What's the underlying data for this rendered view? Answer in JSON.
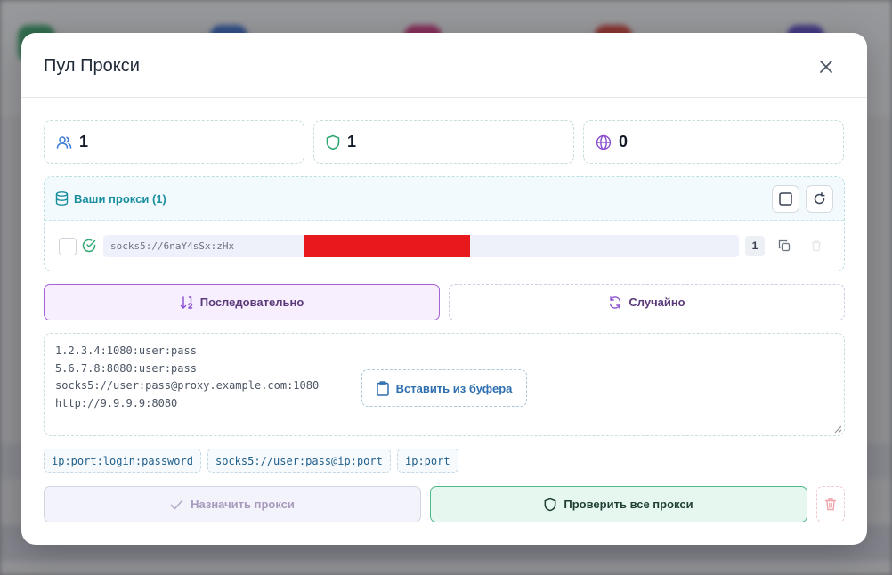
{
  "modal": {
    "title": "Пул Прокси"
  },
  "stats": {
    "users": "1",
    "valid": "1",
    "countries": "0"
  },
  "proxy_panel": {
    "title": "Ваши прокси (1)",
    "items": [
      {
        "value": "socks5://6naY4sSx:zHx",
        "count": "1",
        "status": "valid"
      }
    ]
  },
  "mode": {
    "sequential_label": "Последовательно",
    "random_label": "Случайно",
    "selected": "sequential"
  },
  "input": {
    "lines": [
      "1.2.3.4:1080:user:pass",
      "5.6.7.8:8080:user:pass",
      "socks5://user:pass@proxy.example.com:1080",
      "http://9.9.9.9:8080"
    ],
    "paste_label": "Вставить из буфера"
  },
  "formats": [
    "ip:port:login:password",
    "socks5://user:pass@ip:port",
    "ip:port"
  ],
  "actions": {
    "assign_label": "Назначить прокси",
    "check_label": "Проверить все прокси"
  },
  "colors": {
    "accent_teal": "#1b8fa0",
    "accent_purple": "#a663d6",
    "accent_green": "#4db88a",
    "redaction": "#e8191c"
  }
}
